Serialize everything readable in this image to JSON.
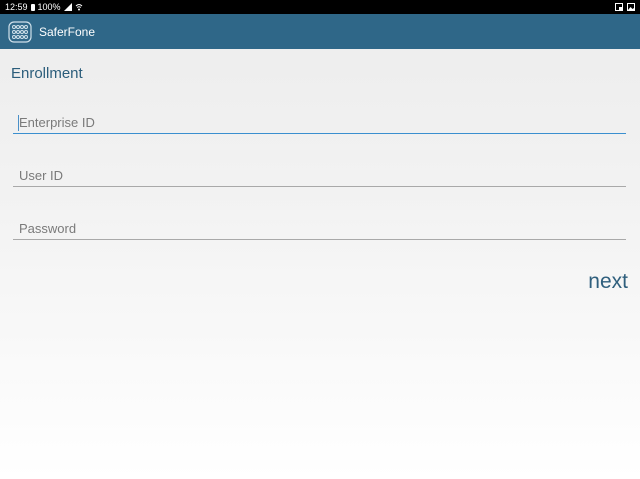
{
  "status_bar": {
    "time": "12:59",
    "battery": "100%",
    "icons": [
      "battery-icon",
      "signal-icon",
      "wifi-icon",
      "cast-icon",
      "image-icon"
    ]
  },
  "app_bar": {
    "title": "SaferFone",
    "logo_icon": "saferfone-logo-icon",
    "background": "#2f6788"
  },
  "page": {
    "title": "Enrollment"
  },
  "form": {
    "enterprise_id": {
      "value": "",
      "placeholder": "Enterprise ID"
    },
    "user_id": {
      "value": "",
      "placeholder": "User ID"
    },
    "password": {
      "value": "",
      "placeholder": "Password"
    }
  },
  "actions": {
    "next_label": "next"
  },
  "colors": {
    "accent": "#3a8fcf",
    "title_text": "#2b5d7b"
  }
}
